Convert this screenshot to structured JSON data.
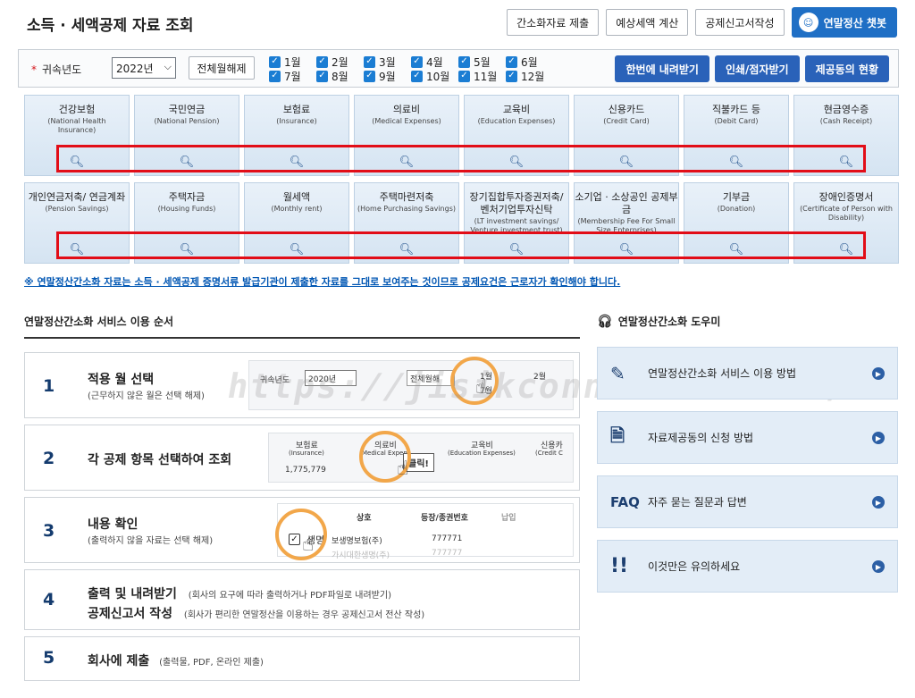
{
  "header": {
    "title": "소득 · 세액공제 자료 조회",
    "buttons": [
      "간소화자료 제출",
      "예상세액 계산",
      "공제신고서작성"
    ],
    "chatbot": "연말정산 챗봇"
  },
  "year_bar": {
    "label": "귀속년도",
    "year": "2022년",
    "clear_button": "전체월해제",
    "months": [
      "1월",
      "2월",
      "3월",
      "4월",
      "5월",
      "6월",
      "7월",
      "8월",
      "9월",
      "10월",
      "11월",
      "12월"
    ],
    "actions": [
      "한번에 내려받기",
      "인쇄/점자받기",
      "제공동의 현황"
    ]
  },
  "categories_row1": [
    {
      "ko": "건강보험",
      "en": "(National Health Insurance)"
    },
    {
      "ko": "국민연금",
      "en": "(National Pension)"
    },
    {
      "ko": "보험료",
      "en": "(Insurance)"
    },
    {
      "ko": "의료비",
      "en": "(Medical Expenses)"
    },
    {
      "ko": "교육비",
      "en": "(Education Expenses)"
    },
    {
      "ko": "신용카드",
      "en": "(Credit Card)"
    },
    {
      "ko": "직불카드 등",
      "en": "(Debit Card)"
    },
    {
      "ko": "현금영수증",
      "en": "(Cash Receipt)"
    }
  ],
  "categories_row2": [
    {
      "ko": "개인연금저축/ 연금계좌",
      "en": "(Pension Savings)"
    },
    {
      "ko": "주택자금",
      "en": "(Housing Funds)"
    },
    {
      "ko": "월세액",
      "en": "(Monthly rent)"
    },
    {
      "ko": "주택마련저축",
      "en": "(Home Purchasing Savings)"
    },
    {
      "ko": "장기집합투자증권저축/ 벤처기업투자신탁",
      "en": "(LT investment savings/ Venture investment trust)"
    },
    {
      "ko": "소기업 · 소상공인 공제부금",
      "en": "(Membership Fee For Small Size Enterprises)"
    },
    {
      "ko": "기부금",
      "en": "(Donation)"
    },
    {
      "ko": "장애인증명서",
      "en": "(Certificate of Person with Disability)"
    }
  ],
  "notice": "※ 연말정산간소화 자료는 소득 · 세액공제 증명서류 발급기관이 제출한 자료를 그대로 보여주는 것이므로 공제요건은 근로자가 확인해야 합니다.",
  "service": {
    "title": "연말정산간소화 서비스 이용 순서",
    "steps": [
      {
        "num": "1",
        "title": "적용 월 선택",
        "sub": "(근무하지 않은 월은 선택 해제)"
      },
      {
        "num": "2",
        "title": "각 공제 항목 선택하여 조회",
        "sub": ""
      },
      {
        "num": "3",
        "title": "내용 확인",
        "sub": "(출력하지 않을 자료는 선택 해제)"
      },
      {
        "num": "4",
        "title": "출력 및 내려받기",
        "sub": "(회사의 요구에 따라 출력하거나 PDF파일로 내려받기)",
        "title2": "공제신고서 작성",
        "sub2": "(회사가 편리한 연말정산을 이용하는 경우 공제신고서 전산 작성)"
      },
      {
        "num": "5",
        "title": "회사에 제출",
        "sub": "(출력물, PDF, 온라인 제출)"
      }
    ],
    "mock1": {
      "label": "귀속년도",
      "year": "2020년",
      "clear": "전체월해",
      "m1": "1월",
      "m7": "7월",
      "m2": "2월"
    },
    "mock2": {
      "c1": "보험료",
      "c1en": "(Insurance)",
      "c1val": "1,775,779",
      "c2": "의료비",
      "c2en": "Medical Expen",
      "click": "클릭!",
      "c3": "교육비",
      "c3en": "(Education Expenses)",
      "c4": "신용카",
      "c4en": "(Credit C"
    },
    "mock3": {
      "h1": "상호",
      "h2": "등장/종권번호",
      "h3": "납입",
      "r1a": "생명",
      "r1b": "보생명보험(주)",
      "r1c": "777771",
      "r2b": "가시대한생명(주)",
      "r2c": "777777"
    }
  },
  "watermark": "https://jisikconnection.com/",
  "helper": {
    "title": "연말정산간소화 도우미",
    "items": [
      {
        "icon": "edit-doc-icon",
        "label": "연말정산간소화 서비스 이용 방법"
      },
      {
        "icon": "doc-icon",
        "label": "자료제공동의 신청 방법"
      },
      {
        "icon": "faq-icon",
        "label": "자주 묻는 질문과 답변",
        "prefix": "FAQ"
      },
      {
        "icon": "alert-icon",
        "label": "이것만은 유의하세요"
      }
    ]
  }
}
